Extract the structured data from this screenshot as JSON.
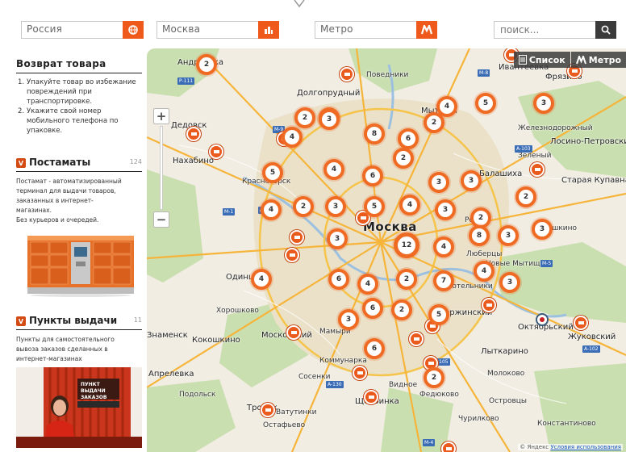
{
  "filters": {
    "country": "Россия",
    "city": "Москва",
    "metro": "Метро",
    "search_placeholder": "поиск..."
  },
  "colors": {
    "accent": "#ef5a1c",
    "badge": "#d34a12",
    "map_bg": "#f1ede2"
  },
  "sidebar": {
    "return_title": "Возврат товара",
    "return_steps": [
      {
        "num": "1.",
        "text": "Упакуйте товар во избежание повреждений при транспортировке."
      },
      {
        "num": "2.",
        "text": "Укажите свой номер мобильного телефона по упаковке."
      }
    ],
    "postamats": {
      "icon": "postamat-icon",
      "badge": "V",
      "title": "Постаматы",
      "count": "124",
      "desc_lines": [
        "Постамат - автоматизированный",
        "терминал для выдачи товаров,",
        "заказанных в интернет-",
        "магазинах.",
        "Без курьеров и очередей."
      ]
    },
    "pickup_points": {
      "icon": "pickup-point-icon",
      "badge": "V",
      "title": "Пункты выдачи",
      "count": "11",
      "desc_lines": [
        "Пункты для самостоятельного",
        "вывоза заказов сделанных в",
        "интернет-магазинах"
      ],
      "photo_sign": "ПУНКТ ВЫДАЧИ ЗАКАЗОВ"
    }
  },
  "map": {
    "view_tabs": {
      "list": "Список",
      "metro": "Метро"
    },
    "zoom_in": "+",
    "zoom_out": "−",
    "city_label": "Москва",
    "labels": [
      "Андреевка",
      "Долгопрудный",
      "Поведники",
      "Ивантеевка",
      "Фрязино",
      "Дедовск",
      "Нахабино",
      "Красногорск",
      "Мытищи",
      "Балашиха",
      "Лосино-Петровский",
      "Старая Купавна",
      "Одинцово",
      "Реутов",
      "Люберцы",
      "Котельники",
      "Дзержинский",
      "Лыткарино",
      "Октябрьский",
      "Жуковский",
      "Видное",
      "Щербинка",
      "Апрелевка",
      "Троицк",
      "Коммунарка",
      "Московский",
      "Знаменск",
      "Кокошкино",
      "Мамыри",
      "Сосенки",
      "Остафьево",
      "Подольск",
      "Ватутинки",
      "Федюково",
      "Чурилково",
      "Константиново",
      "Молоково",
      "Островцы",
      "Железнодорожный",
      "Новые Мытищи",
      "Зеленый",
      "Хорошково",
      "Пушкино"
    ],
    "clusters": [
      "2",
      "2",
      "8",
      "6",
      "3",
      "4",
      "4",
      "3",
      "5",
      "5",
      "4",
      "6",
      "2",
      "3",
      "3",
      "2",
      "2",
      "3",
      "5",
      "3",
      "4",
      "2",
      "3",
      "4",
      "2",
      "12",
      "3",
      "4",
      "8",
      "3",
      "4",
      "6",
      "4",
      "2",
      "7",
      "3",
      "4",
      "6",
      "3",
      "2",
      "6",
      "5",
      "3",
      "2"
    ],
    "attribution": "© Яндекс",
    "terms": "Условия использования"
  }
}
